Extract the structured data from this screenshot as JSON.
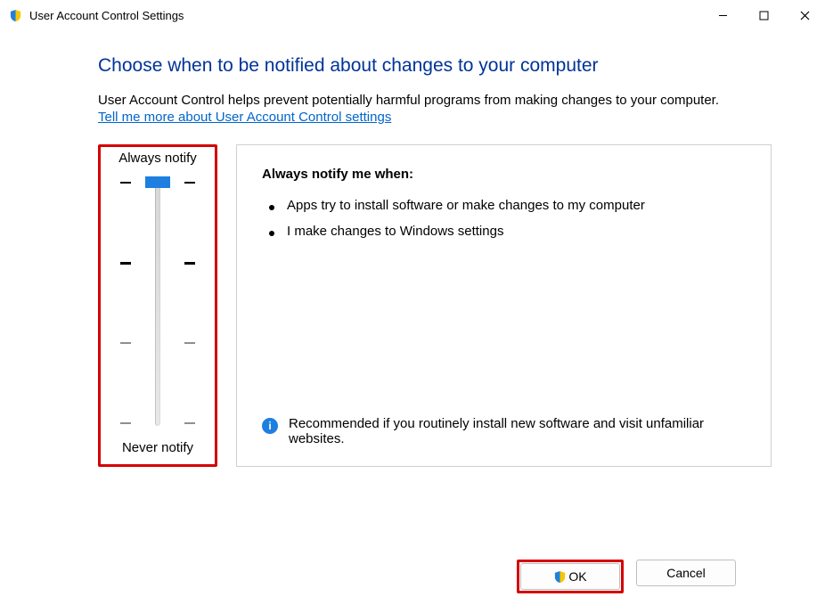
{
  "window": {
    "title": "User Account Control Settings"
  },
  "heading": "Choose when to be notified about changes to your computer",
  "description": "User Account Control helps prevent potentially harmful programs from making changes to your computer.",
  "link": "Tell me more about User Account Control settings",
  "slider": {
    "top_label": "Always notify",
    "bottom_label": "Never notify",
    "position_index": 0,
    "steps": 4
  },
  "panel": {
    "title": "Always notify me when:",
    "bullets": [
      "Apps try to install software or make changes to my computer",
      "I make changes to Windows settings"
    ],
    "recommendation": "Recommended if you routinely install new software and visit unfamiliar websites."
  },
  "buttons": {
    "ok": "OK",
    "cancel": "Cancel"
  }
}
